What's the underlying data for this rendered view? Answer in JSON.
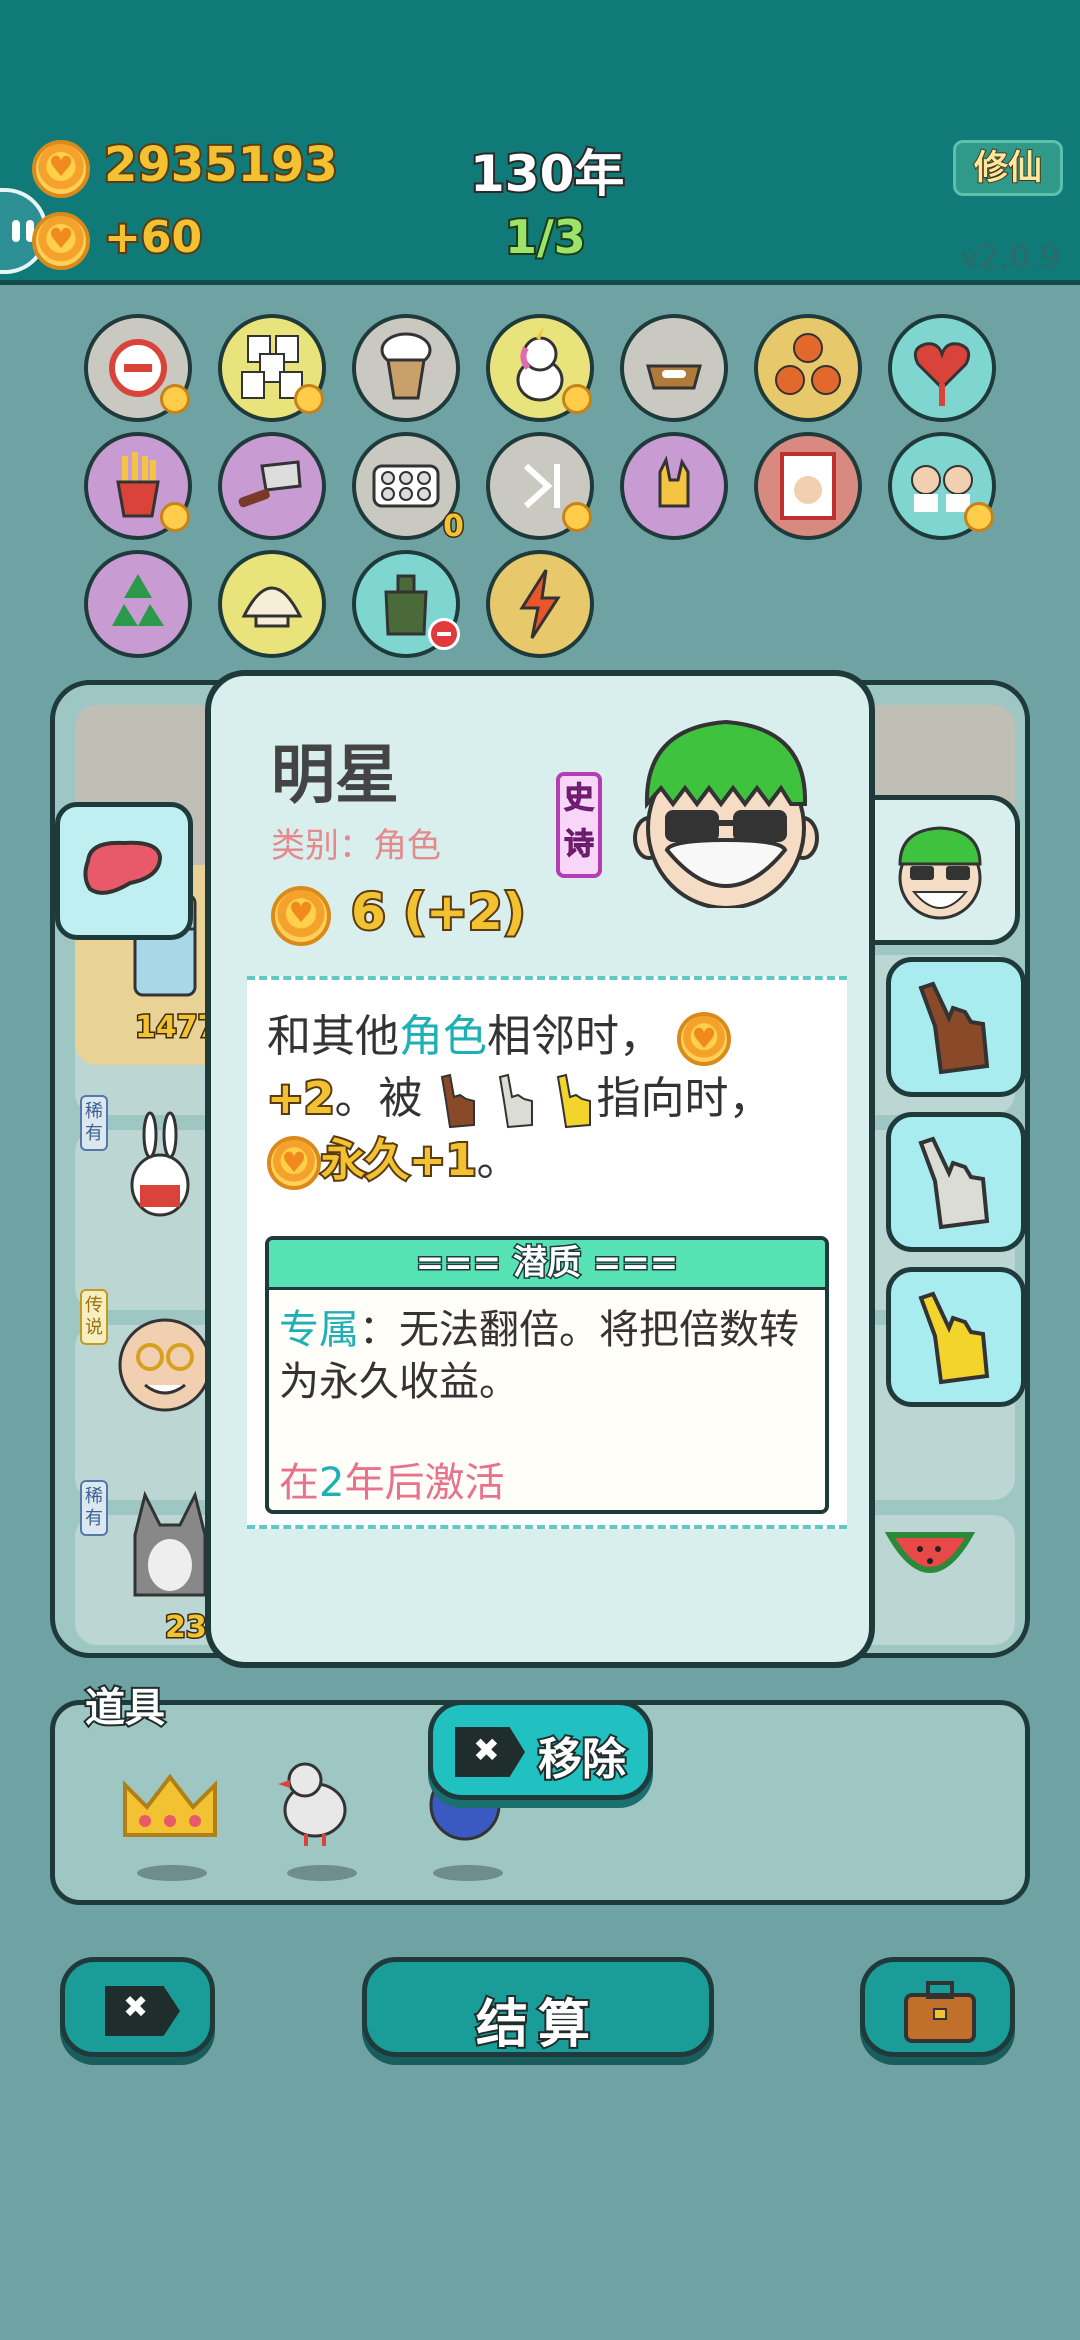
{
  "header": {
    "coins_total": "2935193",
    "coins_rate": "+60",
    "year": "130年",
    "round": "1/3",
    "mode_button": "修仙",
    "version": "v2.0.9"
  },
  "slots": {
    "row1": [
      "minus-sign-icon",
      "wang-tiles-icon",
      "bubble-tea-icon",
      "unicorn-icon",
      "dog-bowl-icon",
      "basketballs-icon",
      "heart-bag-icon"
    ],
    "row2": [
      "fries-icon",
      "cleaver-icon",
      "egg-tray-icon",
      "skip-icon",
      "rock-hand-icon",
      "time-cover-icon",
      "twins-icon"
    ],
    "row3": [
      "recycle-icon",
      "shell-icon",
      "bag-icon",
      "lightning-icon"
    ],
    "egg_tray_count": "0"
  },
  "board": {
    "fridge_count": "1477",
    "husky_count": "23",
    "rarity_rare": "稀有",
    "rarity_legend": "传说",
    "rarity_rare2": "稀有"
  },
  "card": {
    "title": "明星",
    "type_label": "类别：角色",
    "value": "6 (+2)",
    "rarity": "史诗",
    "desc": {
      "l1_a": "和其他",
      "l1_b": "角色",
      "l1_c": "相邻时，",
      "l2_a": "+2",
      "l2_b": "。被",
      "l2_c": "指向时，",
      "l3_a": "永久+1",
      "l3_b": "。"
    },
    "potential": {
      "header": "=== 潜质 ===",
      "key": "专属",
      "text": "：无法翻倍。将把倍数转为永久收益。",
      "activate_a": "在",
      "activate_num": "2",
      "activate_b": "年后激活"
    }
  },
  "remove_button": "移除",
  "props": {
    "label": "道具",
    "items": [
      "crown-icon",
      "bird-icon",
      "ball-icon"
    ]
  },
  "bottom": {
    "settle": "结算"
  },
  "colors": {
    "header_bg": "#0f7a78",
    "accent_teal": "#1fb0b6",
    "gold": "#f2c233",
    "epic": "#c42ac4"
  }
}
